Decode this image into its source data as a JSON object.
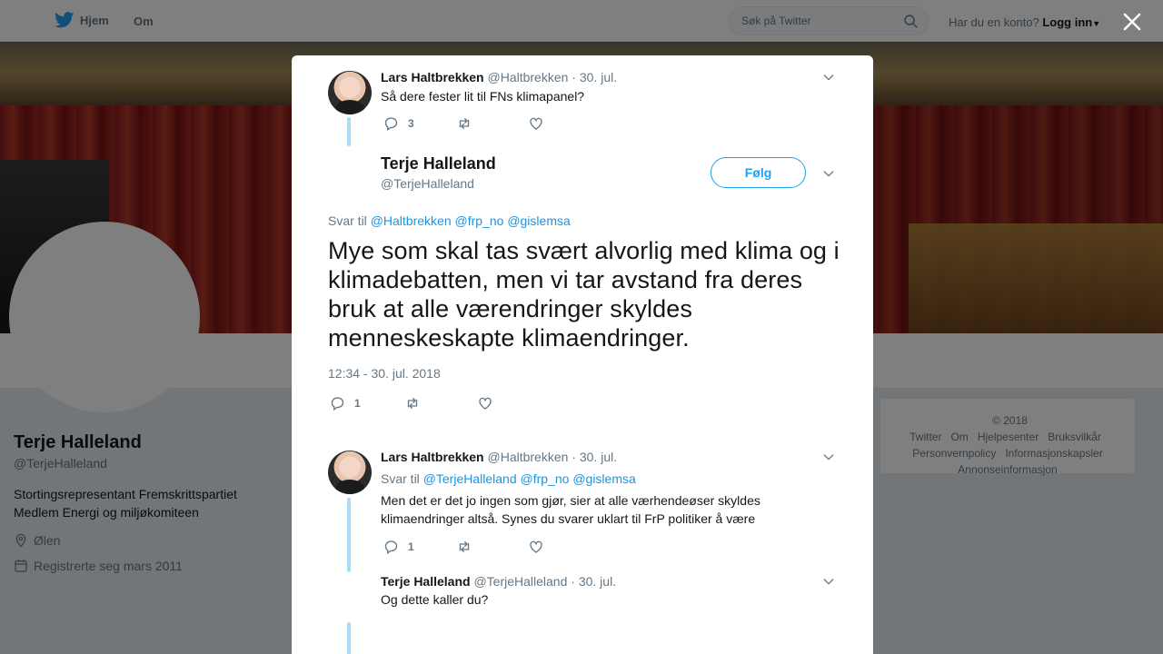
{
  "topbar": {
    "home_label": "Hjem",
    "about_label": "Om",
    "search_placeholder": "Søk på Twitter",
    "have_account": "Har du en konto?",
    "login_label": "Logg inn"
  },
  "profile": {
    "name": "Terje Halleland",
    "handle": "@TerjeHalleland",
    "bio_line1": "Stortingsrepresentant Fremskrittspartiet",
    "bio_line2": "Medlem Energi og miljøkomiteen",
    "location": "Ølen",
    "joined": "Registrerte seg mars 2011"
  },
  "footer": {
    "links": [
      "© 2018 Twitter",
      "Om",
      "Hjelpesenter",
      "Bruksvilkår",
      "Personvernpolicy",
      "Informasjonskapsler",
      "Annonseinformasjon"
    ]
  },
  "modal": {
    "tweet1": {
      "name": "Lars Haltbrekken",
      "handle": "@Haltbrekken",
      "date": "· 30. jul.",
      "text": "Så dere fester lit til FNs klimapanel?",
      "replies": "3"
    },
    "main": {
      "name": "Terje Halleland",
      "handle": "@TerjeHalleland",
      "follow_label": "Følg",
      "reply_prefix": "Svar til",
      "reply_mentions": [
        "@Haltbrekken",
        "@frp_no",
        "@gislemsa"
      ],
      "text": "Mye som skal tas svært alvorlig med klima og i klimadebatten, men vi tar avstand fra deres bruk at alle værendringer skyldes menneskeskapte klimaendringer.",
      "timestamp": "12:34 - 30. jul. 2018",
      "replies": "1"
    },
    "tweet2": {
      "name": "Lars Haltbrekken",
      "handle": "@Haltbrekken",
      "date": "· 30. jul.",
      "reply_prefix": "Svar til",
      "reply_mentions": [
        "@TerjeHalleland",
        "@frp_no",
        "@gislemsa"
      ],
      "text_line1": "Men det er det jo ingen som gjør, sier at alle værhendeøser skyldes",
      "text_line2": "klimaendringer altså. Synes du svarer uklart til FrP politiker å være",
      "replies": "1"
    },
    "tweet3": {
      "name": "Terje Halleland",
      "handle": "@TerjeHalleland",
      "date": "· 30. jul.",
      "text": "Og dette kaller du?"
    }
  },
  "colors": {
    "accent": "#1da1f2",
    "link": "#1b95e0",
    "muted": "#657786",
    "thread": "#aadcf6"
  }
}
